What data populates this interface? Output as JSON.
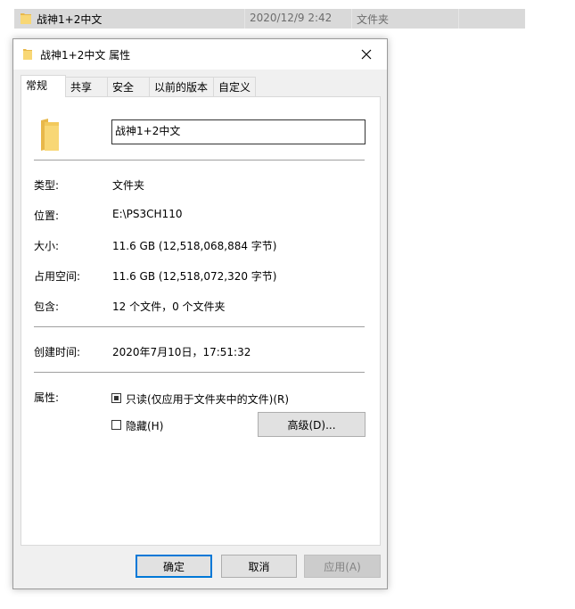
{
  "explorer": {
    "file_name": "战神1+2中文",
    "date": "2020/12/9 2:42",
    "type": "文件夹"
  },
  "dialog": {
    "title": "战神1+2中文 属性",
    "tabs": [
      "常规",
      "共享",
      "安全",
      "以前的版本",
      "自定义"
    ],
    "name_value": "战神1+2中文",
    "rows": [
      {
        "label": "类型:",
        "value": "文件夹"
      },
      {
        "label": "位置:",
        "value": "E:\\PS3CH110"
      },
      {
        "label": "大小:",
        "value": "11.6 GB (12,518,068,884 字节)"
      },
      {
        "label": "占用空间:",
        "value": "11.6 GB (12,518,072,320 字节)"
      },
      {
        "label": "包含:",
        "value": "12 个文件，0 个文件夹"
      }
    ],
    "created_label": "创建时间:",
    "created_value": "2020年7月10日，17:51:32",
    "attributes_label": "属性:",
    "readonly_label": "只读(仅应用于文件夹中的文件)(R)",
    "readonly_checked": true,
    "hidden_label": "隐藏(H)",
    "hidden_checked": false,
    "advanced_label": "高级(D)...",
    "ok_label": "确定",
    "cancel_label": "取消",
    "apply_label": "应用(A)"
  },
  "colors": {
    "folder_yellow": "#f8d775",
    "folder_dark": "#e8b84a",
    "accent_blue": "#0078d7"
  }
}
